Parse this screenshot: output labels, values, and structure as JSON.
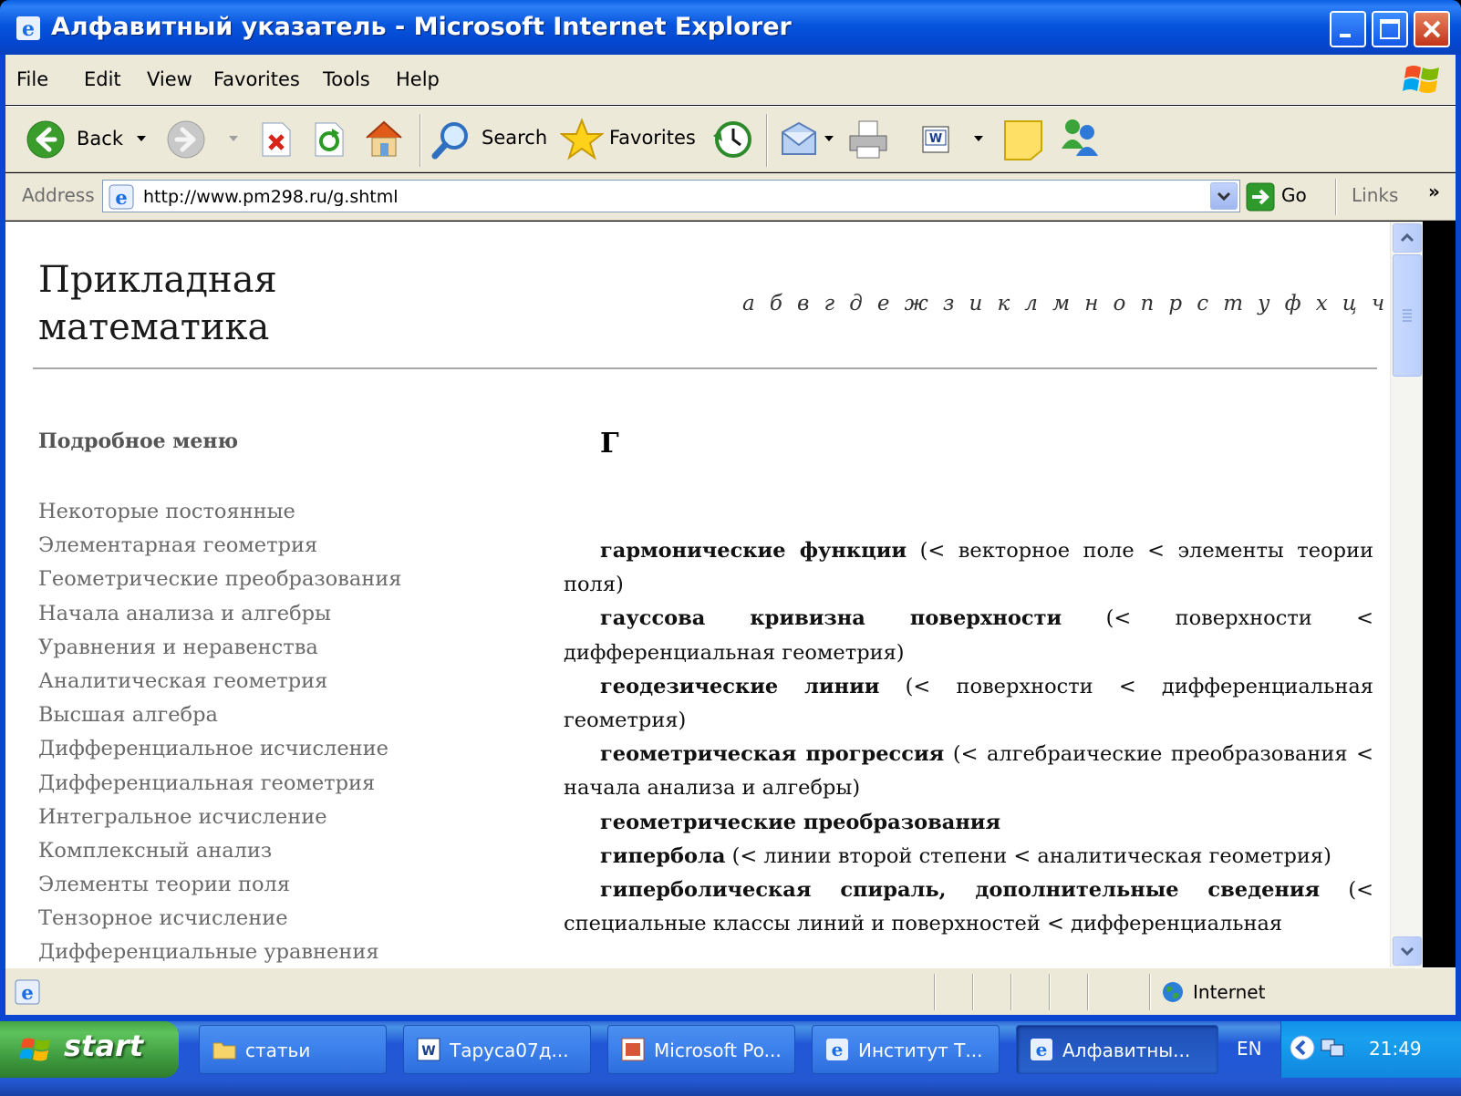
{
  "window": {
    "title": "Алфавитный указатель - Microsoft Internet Explorer"
  },
  "menubar": {
    "items": [
      "File",
      "Edit",
      "View",
      "Favorites",
      "Tools",
      "Help"
    ]
  },
  "toolbar": {
    "back_label": "Back",
    "search_label": "Search",
    "favorites_label": "Favorites"
  },
  "addressbar": {
    "label": "Address",
    "url": "http://www.pm298.ru/g.shtml",
    "go_label": "Go",
    "links_label": "Links",
    "chevron": "»"
  },
  "page": {
    "site_title": "Прикладная математика",
    "alphabet": "а б в г д е ж з и к л м н о п р с т у ф х ц ч ш щ э ю я",
    "menu_heading": "Подробное меню",
    "menu_items": [
      "Некоторые постоянные",
      "Элементарная геометрия",
      "Геометрические преобразования",
      "Начала анализа и алгебры",
      "Уравнения и неравенства",
      "Аналитическая геометрия",
      "Высшая алгебра",
      "Дифференциальное исчисление",
      "Дифференциальная геометрия",
      "Интегральное исчисление",
      "Комплексный анализ",
      "Элементы теории поля",
      "Тензорное исчисление",
      "Дифференциальные уравнения"
    ],
    "letter": "Г",
    "entries": [
      {
        "term": "гармонические функции",
        "context": " (< векторное поле < элементы теории поля)"
      },
      {
        "term": "гауссова кривизна поверхности",
        "context": " (< поверхности < дифференциальная геометрия)"
      },
      {
        "term": "геодезические линии",
        "context": " (< поверхности < дифференциальная геометрия)"
      },
      {
        "term": "геометрическая прогрессия",
        "context": " (< алгебраические преобразования < начала анализа и алгебры)"
      },
      {
        "term": "геометрические преобразования",
        "context": ""
      },
      {
        "term": "гипербола",
        "context": " (< линии второй степени < аналитическая геометрия)"
      },
      {
        "term": "гиперболическая спираль, дополнительные сведения",
        "context": " (< специальные классы линий и поверхностей < дифференциальная"
      }
    ]
  },
  "statusbar": {
    "zone": "Internet"
  },
  "taskbar": {
    "start_label": "start",
    "tasks": [
      {
        "label": "статьи",
        "icon": "folder-icon"
      },
      {
        "label": "Таруса07д...",
        "icon": "word-icon"
      },
      {
        "label": "Microsoft Po...",
        "icon": "powerpoint-icon"
      },
      {
        "label": "Институт Т...",
        "icon": "ie-icon"
      },
      {
        "label": "Алфавитны...",
        "icon": "ie-icon"
      }
    ],
    "language": "EN",
    "clock": "21:49"
  },
  "colors": {
    "title_bar": "#0755dd",
    "chrome": "#ece9d8",
    "start_green": "#3c963c",
    "taskbar_blue": "#2458d2"
  }
}
